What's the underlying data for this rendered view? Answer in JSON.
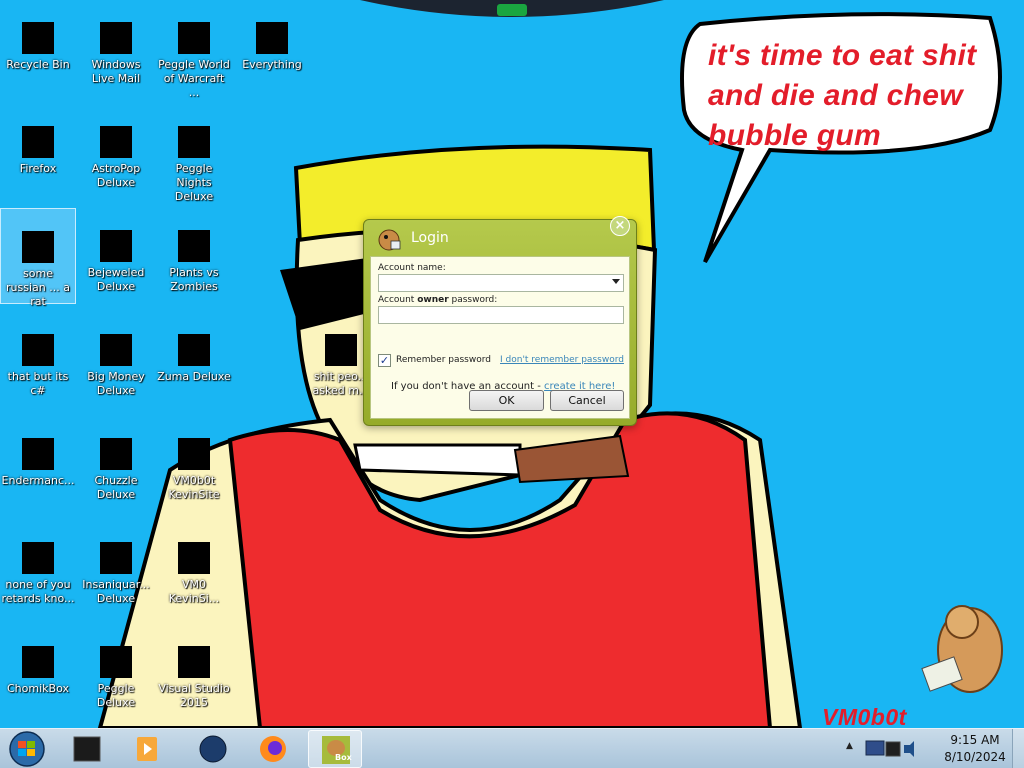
{
  "wallpaper": {
    "speech_text": "it's time to eat shit and die and chew bubble gum",
    "watermark": "VM0b0t",
    "background_color": "#19b6f3"
  },
  "desktop_icons": [
    {
      "label": "Recycle Bin",
      "icon": "recycle-bin-icon"
    },
    {
      "label": "Windows Live Mail",
      "icon": "mail-icon"
    },
    {
      "label": "Peggle World of Warcraft ...",
      "icon": "peggle-icon"
    },
    {
      "label": "Everything",
      "icon": "search-app-icon"
    },
    {
      "label": "Firefox",
      "icon": "firefox-icon"
    },
    {
      "label": "AstroPop Deluxe",
      "icon": "game-icon"
    },
    {
      "label": "Peggle Nights Deluxe",
      "icon": "peggle-icon"
    },
    {
      "label": "some russian ... a rat",
      "icon": "file-icon"
    },
    {
      "label": "Bejeweled Deluxe",
      "icon": "game-icon"
    },
    {
      "label": "Plants vs Zombies",
      "icon": "game-icon"
    },
    {
      "label": "that but its c#",
      "icon": "file-icon"
    },
    {
      "label": "Big Money Deluxe",
      "icon": "game-icon"
    },
    {
      "label": "Zuma Deluxe",
      "icon": "game-icon"
    },
    {
      "label": "Endermanc...",
      "icon": "terminal-icon"
    },
    {
      "label": "Chuzzle Deluxe",
      "icon": "game-icon"
    },
    {
      "label": "VM0b0t KevinSite",
      "icon": "app-icon"
    },
    {
      "label": "none of you retards kno...",
      "icon": "file-icon"
    },
    {
      "label": "Insaniquar... Deluxe",
      "icon": "game-icon"
    },
    {
      "label": "VM0 KevinSi...",
      "icon": "app-icon"
    },
    {
      "label": "ChomikBox",
      "icon": "chomikbox-icon"
    },
    {
      "label": "Peggle Deluxe",
      "icon": "peggle-icon"
    },
    {
      "label": "Visual Studio 2015",
      "icon": "visual-studio-icon"
    },
    {
      "label": "shit peo... asked m...",
      "icon": "folder-icon"
    }
  ],
  "dialog": {
    "title": "Login",
    "account_name_label": "Account name:",
    "password_label_prefix": "Account ",
    "password_label_bold": "owner",
    "password_label_suffix": " password:",
    "remember_label": "Remember password",
    "remember_checked": true,
    "remember_check_glyph": "✓",
    "forgot_link": "I don't remember password",
    "signup_prefix": "If you don't have an account - ",
    "signup_link": "create it here!",
    "ok_label": "OK",
    "cancel_label": "Cancel",
    "close_glyph": "×",
    "accent_color": "#a6bb3c"
  },
  "taskbar": {
    "time": "9:15 AM",
    "date": "8/10/2024",
    "tray_arrow": "▲",
    "pinned": [
      {
        "name": "taskbar-button-explorer",
        "icon": "console-icon"
      },
      {
        "name": "taskbar-button-media-player",
        "icon": "media-player-icon"
      },
      {
        "name": "taskbar-button-globe",
        "icon": "globe-icon"
      },
      {
        "name": "taskbar-button-firefox",
        "icon": "firefox-icon"
      },
      {
        "name": "taskbar-button-chomikbox",
        "icon": "chomikbox-icon",
        "active": true,
        "label": "Box"
      }
    ]
  }
}
